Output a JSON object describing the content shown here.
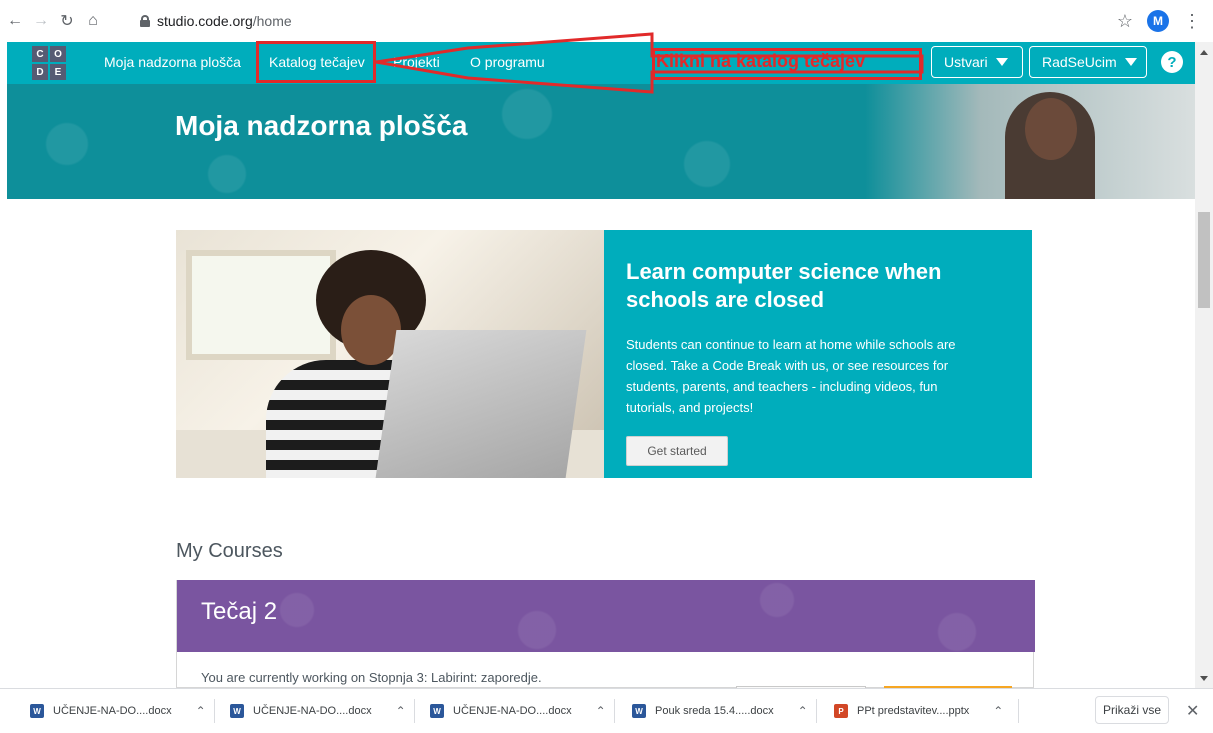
{
  "browser": {
    "url_host": "studio.code.org",
    "url_path": "/home",
    "profile_initial": "M"
  },
  "nav": {
    "logo_letters": [
      "C",
      "O",
      "D",
      "E"
    ],
    "links": [
      "Moja nadzorna plošča",
      "Katalog tečajev",
      "Projekti",
      "O programu"
    ],
    "create_label": "Ustvari",
    "user_label": "RadSeUcim",
    "help_label": "?"
  },
  "annotation": {
    "instruction": "Klikni na katalog tečajev",
    "color": "#e12a2a"
  },
  "hero": {
    "title": "Moja nadzorna plošča"
  },
  "promo": {
    "title": "Learn computer science when schools are closed",
    "body": "Students can continue to learn at home while schools are closed. Take a Code Break with us, or see resources for students, parents, and teachers - including videos, fun tutorials, and projects!",
    "button": "Get started"
  },
  "courses": {
    "section_title": "My Courses",
    "course_title": "Tečaj 2",
    "status": "You are currently working on Stopnja 3: Labirint: zaporedje."
  },
  "downloads": {
    "items": [
      {
        "name": "UČENJE-NA-DO....docx",
        "type": "word"
      },
      {
        "name": "UČENJE-NA-DO....docx",
        "type": "word"
      },
      {
        "name": "UČENJE-NA-DO....docx",
        "type": "word"
      },
      {
        "name": "Pouk sreda 15.4.....docx",
        "type": "word"
      },
      {
        "name": "PPt predstavitev....pptx",
        "type": "ppt"
      }
    ],
    "show_all": "Prikaži vse"
  },
  "colors": {
    "nav_bg": "#00adbc",
    "hero_bg": "#0c8c96",
    "course_bg": "#7a55a0"
  }
}
